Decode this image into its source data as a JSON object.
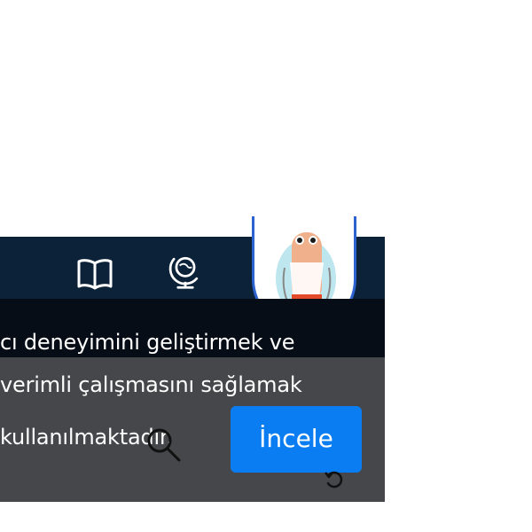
{
  "banner": {
    "lines": [
      "cı deneyimini geliştirmek ve",
      "verimli çalışmasını sağlamak",
      "kullanılmaktadır."
    ],
    "button_label": "İncele"
  },
  "nav": {
    "icons": [
      "book-icon",
      "globe-icon"
    ]
  },
  "colors": {
    "nav_bg": "#0b2238",
    "strip_bg": "#070d16",
    "panel_bg": "#45474a",
    "button_bg": "#0a7df2",
    "avatar_border": "#2d63d0"
  }
}
